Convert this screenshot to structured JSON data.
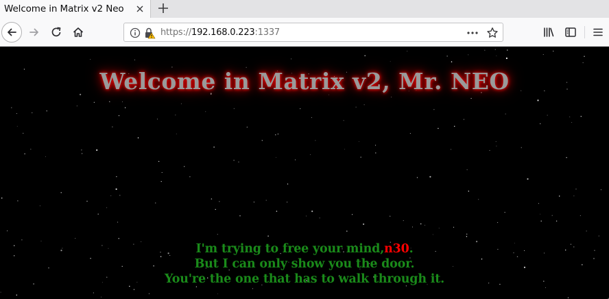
{
  "browser": {
    "tab": {
      "title": "Welcome in Matrix v2 Neo"
    },
    "url": {
      "scheme": "https://",
      "host": "192.168.0.223",
      "port": ":1337"
    }
  },
  "page": {
    "heading": "Welcome in Matrix v2, Mr. NEO",
    "line1_prefix": "I'm trying to free your mind,",
    "line1_highlight": "n30",
    "line1_suffix": ".",
    "line2": "But I can only show you the door.",
    "line3": "You're the one that has to walk through it."
  },
  "colors": {
    "background": "#000000",
    "heading_text": "#9a9a9a",
    "heading_glow": "#ff0000",
    "message_text": "#1a8a1a",
    "highlight": "#ff0000"
  }
}
